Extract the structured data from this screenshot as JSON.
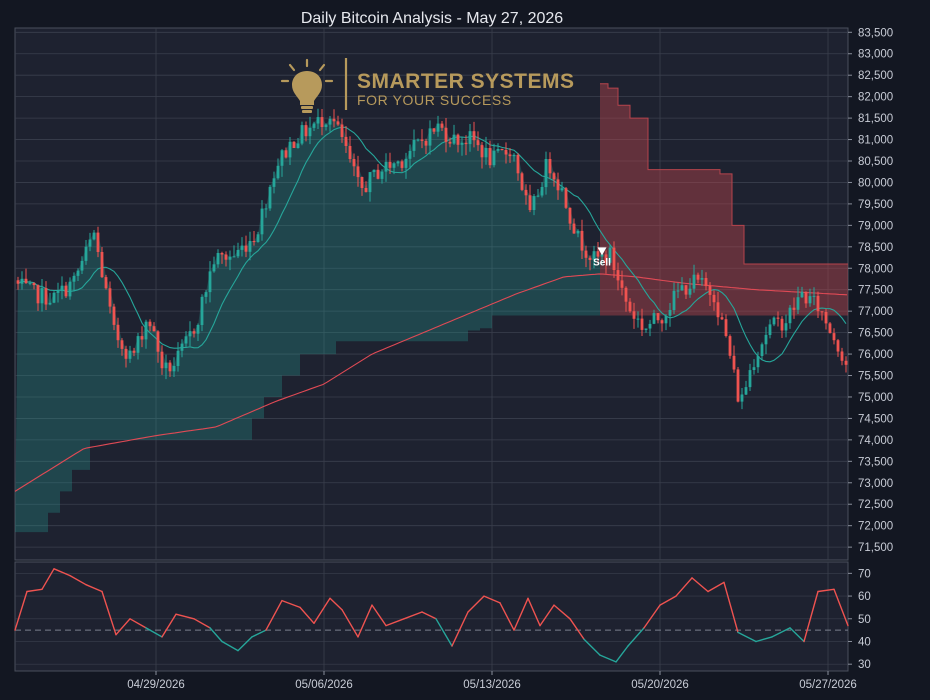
{
  "chart_data": {
    "type": "candlestick",
    "title": "Daily Bitcoin Analysis - May 27, 2026",
    "watermark": {
      "line1": "SMARTER SYSTEMS",
      "line2": "FOR YOUR SUCCESS",
      "icon": "lightbulb-icon",
      "color": "#b79a5c"
    },
    "colors": {
      "background": "#1e2230",
      "up": "#26a69a",
      "down": "#ef5350",
      "ma_long": "#e04a55",
      "ma_short": "#26a69a",
      "band_bull": "#26a69a",
      "band_bear": "#b5444c",
      "rsi_bull": "#26a69a",
      "rsi_bear": "#ef5350",
      "grid": "#3a3f4d",
      "text": "#c8ccd6"
    },
    "grid": true,
    "price_axis": {
      "position": "right",
      "range": [
        71200,
        83600
      ],
      "ticks": [
        "83,500",
        "83,000",
        "82,500",
        "82,000",
        "81,500",
        "81,000",
        "80,500",
        "80,000",
        "79,500",
        "79,000",
        "78,500",
        "78,000",
        "77,500",
        "77,000",
        "76,500",
        "76,000",
        "75,500",
        "75,000",
        "74,500",
        "74,000",
        "73,500",
        "73,000",
        "72,500",
        "72,000",
        "71,500"
      ]
    },
    "x_axis": {
      "range": [
        "2026-04-23 03:00",
        "2026-05-27 20:00"
      ],
      "tick_dates": [
        "2026-04-29",
        "2026-05-06",
        "2026-05-13",
        "2026-05-20",
        "2026-05-27"
      ],
      "tick_labels": [
        "04/29/2026",
        "05/06/2026",
        "05/13/2026",
        "05/20/2026",
        "05/27/2026"
      ]
    },
    "candle_interval_hours": 4,
    "price_keypoints": [
      [
        "2026-04-23 06:00",
        77600
      ],
      [
        "2026-04-23 22:00",
        77400
      ],
      [
        "2026-04-24 18:00",
        77300
      ],
      [
        "2026-04-25 14:00",
        77700
      ],
      [
        "2026-04-26 10:00",
        78800
      ],
      [
        "2026-04-27 06:00",
        76500
      ],
      [
        "2026-04-28 00:00",
        75900
      ],
      [
        "2026-04-28 16:00",
        76900
      ],
      [
        "2026-04-29 08:00",
        75600
      ],
      [
        "2026-04-29 20:00",
        75800
      ],
      [
        "2026-04-30 16:00",
        76700
      ],
      [
        "2026-05-01 10:00",
        78200
      ],
      [
        "2026-05-02 06:00",
        78300
      ],
      [
        "2026-05-03 04:00",
        78800
      ],
      [
        "2026-05-04 00:00",
        80400
      ],
      [
        "2026-05-04 18:00",
        81000
      ],
      [
        "2026-05-05 12:00",
        81300
      ],
      [
        "2026-05-06 06:00",
        81600
      ],
      [
        "2026-05-06 18:00",
        81000
      ],
      [
        "2026-05-07 12:00",
        79800
      ],
      [
        "2026-05-08 08:00",
        80300
      ],
      [
        "2026-05-09 04:00",
        80500
      ],
      [
        "2026-05-09 22:00",
        80900
      ],
      [
        "2026-05-10 18:00",
        81300
      ],
      [
        "2026-05-11 10:00",
        81000
      ],
      [
        "2026-05-12 04:00",
        81000
      ],
      [
        "2026-05-13 00:00",
        80500
      ],
      [
        "2026-05-13 20:00",
        80800
      ],
      [
        "2026-05-14 14:00",
        79200
      ],
      [
        "2026-05-15 08:00",
        80500
      ],
      [
        "2026-05-15 22:00",
        79800
      ],
      [
        "2026-05-16 14:00",
        78700
      ],
      [
        "2026-05-17 06:00",
        78200
      ],
      [
        "2026-05-17 22:00",
        78300
      ],
      [
        "2026-05-18 16:00",
        77100
      ],
      [
        "2026-05-19 08:00",
        76600
      ],
      [
        "2026-05-20 02:00",
        76900
      ],
      [
        "2026-05-20 20:00",
        77500
      ],
      [
        "2026-05-21 12:00",
        77700
      ],
      [
        "2026-05-22 06:00",
        77400
      ],
      [
        "2026-05-22 20:00",
        76200
      ],
      [
        "2026-05-23 08:00",
        74800
      ],
      [
        "2026-05-23 20:00",
        75800
      ],
      [
        "2026-05-24 12:00",
        76600
      ],
      [
        "2026-05-25 06:00",
        76800
      ],
      [
        "2026-05-25 22:00",
        77400
      ],
      [
        "2026-05-26 14:00",
        77100
      ],
      [
        "2026-05-27 06:00",
        76400
      ],
      [
        "2026-05-27 20:00",
        75700
      ]
    ],
    "ma_long": [
      [
        "2026-04-23 03:00",
        72800
      ],
      [
        "2026-04-26 00:00",
        73800
      ],
      [
        "2026-04-29 00:00",
        74100
      ],
      [
        "2026-05-01 12:00",
        74300
      ],
      [
        "2026-05-04 00:00",
        74900
      ],
      [
        "2026-05-06 00:00",
        75300
      ],
      [
        "2026-05-08 00:00",
        76000
      ],
      [
        "2026-05-11 00:00",
        76700
      ],
      [
        "2026-05-14 00:00",
        77400
      ],
      [
        "2026-05-16 00:00",
        77800
      ],
      [
        "2026-05-17 12:00",
        77870
      ],
      [
        "2026-05-19 00:00",
        77800
      ],
      [
        "2026-05-21 00:00",
        77650
      ],
      [
        "2026-05-24 00:00",
        77500
      ],
      [
        "2026-05-27 20:00",
        77380
      ]
    ],
    "cloud": [
      [
        "2026-04-23 03:00",
        71850
      ],
      [
        "2026-04-24 00:00",
        71850
      ],
      [
        "2026-04-24 12:00",
        72300
      ],
      [
        "2026-04-25 00:00",
        72800
      ],
      [
        "2026-04-25 12:00",
        73300
      ],
      [
        "2026-04-26 06:00",
        74000
      ],
      [
        "2026-05-02 18:00",
        74000
      ],
      [
        "2026-05-03 00:00",
        74500
      ],
      [
        "2026-05-03 12:00",
        75000
      ],
      [
        "2026-05-04 06:00",
        75500
      ],
      [
        "2026-05-05 00:00",
        76000
      ],
      [
        "2026-05-06 12:00",
        76300
      ],
      [
        "2026-05-08 00:00",
        76300
      ],
      [
        "2026-05-11 12:00",
        76300
      ],
      [
        "2026-05-12 00:00",
        76550
      ],
      [
        "2026-05-12 12:00",
        76600
      ],
      [
        "2026-05-13 00:00",
        76900
      ],
      [
        "2026-05-17 12:00",
        76900
      ]
    ],
    "bear_band": {
      "top": [
        [
          "2026-05-17 12:00",
          82300
        ],
        [
          "2026-05-17 20:00",
          82200
        ],
        [
          "2026-05-18 06:00",
          81800
        ],
        [
          "2026-05-18 18:00",
          81500
        ],
        [
          "2026-05-19 12:00",
          80300
        ],
        [
          "2026-05-22 00:00",
          80300
        ],
        [
          "2026-05-22 12:00",
          80200
        ],
        [
          "2026-05-23 00:00",
          79000
        ],
        [
          "2026-05-23 12:00",
          78100
        ],
        [
          "2026-05-27 20:00",
          78100
        ]
      ],
      "bottom": [
        [
          "2026-05-17 12:00",
          76900
        ],
        [
          "2026-05-27 20:00",
          76900
        ]
      ]
    },
    "sell_signal": {
      "label": "Sell",
      "date": "2026-05-17 14:00",
      "price": 78300
    },
    "rsi": {
      "ticks": [
        "70",
        "60",
        "50",
        "40",
        "30"
      ],
      "range": [
        27,
        75
      ],
      "reference": 45,
      "values": [
        [
          "2026-04-23 03:00",
          45
        ],
        [
          "2026-04-23 15:00",
          62
        ],
        [
          "2026-04-24 06:00",
          63
        ],
        [
          "2026-04-24 18:00",
          72
        ],
        [
          "2026-04-25 10:00",
          69
        ],
        [
          "2026-04-26 02:00",
          65
        ],
        [
          "2026-04-26 18:00",
          62
        ],
        [
          "2026-04-27 08:00",
          43
        ],
        [
          "2026-04-27 22:00",
          50
        ],
        [
          "2026-04-28 14:00",
          46
        ],
        [
          "2026-04-29 06:00",
          42
        ],
        [
          "2026-04-29 20:00",
          52
        ],
        [
          "2026-04-30 14:00",
          50
        ],
        [
          "2026-05-01 06:00",
          46
        ],
        [
          "2026-05-01 18:00",
          40
        ],
        [
          "2026-05-02 10:00",
          36
        ],
        [
          "2026-05-03 00:00",
          42
        ],
        [
          "2026-05-03 14:00",
          45
        ],
        [
          "2026-05-04 06:00",
          58
        ],
        [
          "2026-05-05 00:00",
          55
        ],
        [
          "2026-05-05 14:00",
          48
        ],
        [
          "2026-05-06 06:00",
          59
        ],
        [
          "2026-05-06 18:00",
          54
        ],
        [
          "2026-05-07 10:00",
          42
        ],
        [
          "2026-05-08 00:00",
          56
        ],
        [
          "2026-05-08 14:00",
          47
        ],
        [
          "2026-05-09 08:00",
          50
        ],
        [
          "2026-05-10 02:00",
          53
        ],
        [
          "2026-05-10 16:00",
          50
        ],
        [
          "2026-05-11 08:00",
          38
        ],
        [
          "2026-05-12 00:00",
          53
        ],
        [
          "2026-05-12 16:00",
          60
        ],
        [
          "2026-05-13 08:00",
          57
        ],
        [
          "2026-05-13 22:00",
          45
        ],
        [
          "2026-05-14 12:00",
          59
        ],
        [
          "2026-05-15 00:00",
          47
        ],
        [
          "2026-05-15 14:00",
          56
        ],
        [
          "2026-05-16 06:00",
          50
        ],
        [
          "2026-05-16 20:00",
          41
        ],
        [
          "2026-05-17 12:00",
          34
        ],
        [
          "2026-05-18 04:00",
          31
        ],
        [
          "2026-05-18 16:00",
          38
        ],
        [
          "2026-05-19 08:00",
          46
        ],
        [
          "2026-05-20 00:00",
          56
        ],
        [
          "2026-05-20 16:00",
          60
        ],
        [
          "2026-05-21 08:00",
          68
        ],
        [
          "2026-05-22 00:00",
          62
        ],
        [
          "2026-05-22 16:00",
          66
        ],
        [
          "2026-05-23 06:00",
          44
        ],
        [
          "2026-05-24 00:00",
          40
        ],
        [
          "2026-05-24 16:00",
          42
        ],
        [
          "2026-05-25 10:00",
          46
        ],
        [
          "2026-05-26 00:00",
          40
        ],
        [
          "2026-05-26 14:00",
          62
        ],
        [
          "2026-05-27 06:00",
          63
        ],
        [
          "2026-05-27 20:00",
          47
        ]
      ]
    }
  }
}
